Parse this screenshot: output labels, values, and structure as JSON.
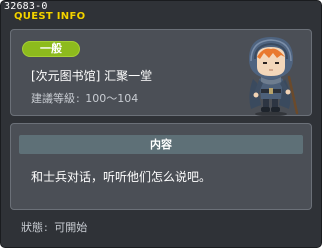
{
  "window": {
    "quest_id": "32683-0",
    "title": "QUEST INFO"
  },
  "quest": {
    "category_badge": "一般",
    "name": "[次元图书馆] 汇聚一堂",
    "level_label": "建議等級",
    "level_separator": ":",
    "level_range": "100～104"
  },
  "content": {
    "header": "内容",
    "text": "和士兵对话，听听他们怎么说吧。"
  },
  "status": {
    "label": "狀態",
    "separator": ":",
    "value": "可開始"
  },
  "npc": {
    "icon": "hooded-soldier-npc-icon"
  },
  "colors": {
    "window_bg": "#2f3237",
    "title": "#f2d300",
    "card_bg": "#4b4f56",
    "badge": "#8dbb1d",
    "content_header": "#5e7077",
    "secondary_text": "#c8ccd2"
  }
}
